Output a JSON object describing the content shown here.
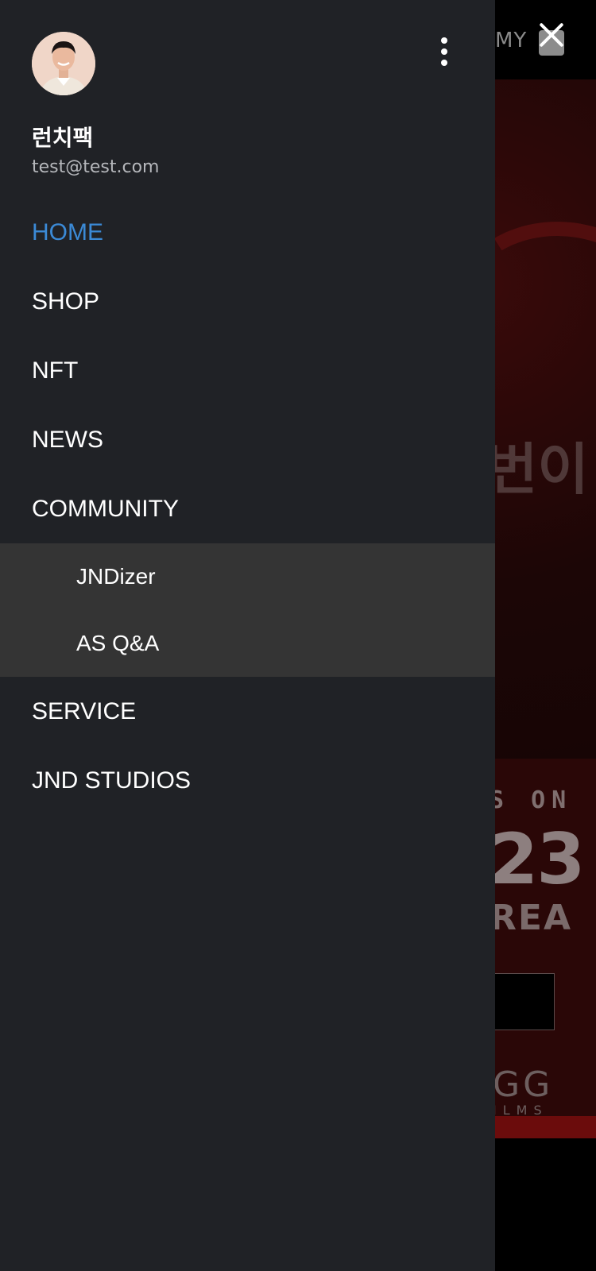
{
  "background": {
    "header_link": "MY",
    "hero_text": "번이",
    "poster": {
      "line1": "S ON",
      "line2": "23",
      "line3": "REA",
      "logo": "GG",
      "logo_sub": "ILMS"
    }
  },
  "drawer": {
    "user": {
      "name": "런치팩",
      "email": "test@test.com"
    },
    "nav": {
      "home": "HOME",
      "shop": "SHOP",
      "nft": "NFT",
      "news": "NEWS",
      "community": "COMMUNITY",
      "community_sub": [
        "JNDizer",
        "AS Q&A"
      ],
      "service": "SERVICE",
      "jnd_studios": "JND STUDIOS"
    },
    "active_item": "HOME"
  },
  "colors": {
    "drawer_bg": "#202226",
    "submenu_bg": "#343434",
    "active": "#3b8ad6"
  },
  "icons": {
    "more": "more-vertical-icon",
    "close": "close-icon",
    "bag": "shopping-bag-icon"
  }
}
